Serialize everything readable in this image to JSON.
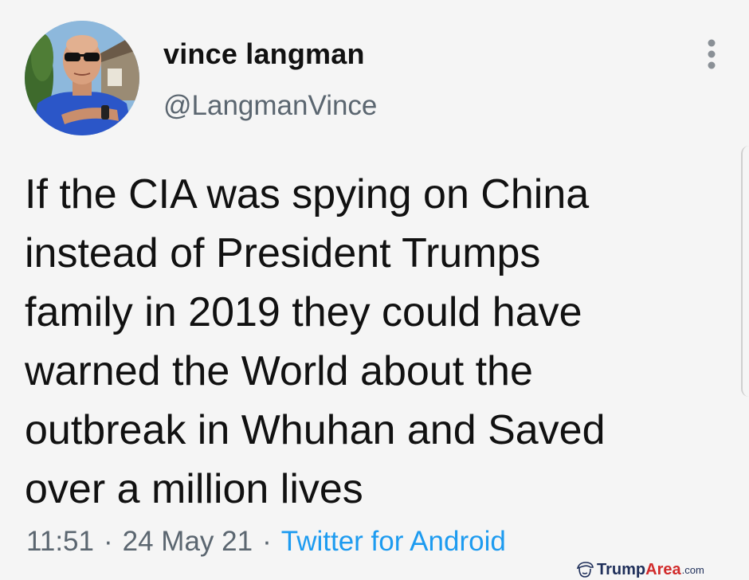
{
  "author": {
    "display_name": "vince langman",
    "handle": "@LangmanVince",
    "avatar_icon": "profile-photo"
  },
  "menu": {
    "icon": "more-vertical-icon"
  },
  "tweet": {
    "text": "If the CIA was spying on China\ninstead of President Trumps\nfamily in 2019 they could have\nwarned the World about the\noutbreak in Whuhan and Saved\nover a million lives",
    "time": "11:51",
    "separator": "·",
    "date": "24 May 21",
    "source": "Twitter for Android"
  },
  "colors": {
    "text": "#111111",
    "secondary_text": "#5b6670",
    "link": "#1d9bf0",
    "background": "#f5f5f5"
  },
  "watermark": {
    "brand_part1": "Trump",
    "brand_part2": "Area",
    "suffix": ".com"
  }
}
